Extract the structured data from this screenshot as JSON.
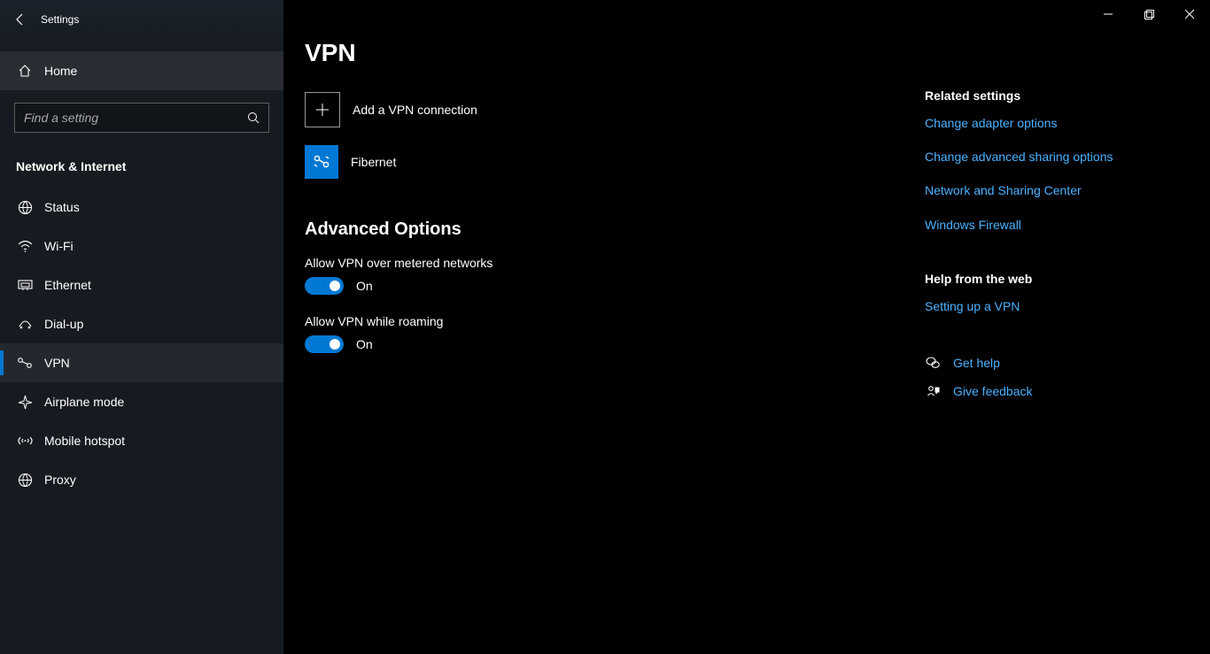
{
  "app_title": "Settings",
  "search_placeholder": "Find a setting",
  "home_label": "Home",
  "section_label": "Network & Internet",
  "nav": [
    {
      "id": "status",
      "label": "Status"
    },
    {
      "id": "wifi",
      "label": "Wi-Fi"
    },
    {
      "id": "ethernet",
      "label": "Ethernet"
    },
    {
      "id": "dialup",
      "label": "Dial-up"
    },
    {
      "id": "vpn",
      "label": "VPN"
    },
    {
      "id": "airplane",
      "label": "Airplane mode"
    },
    {
      "id": "hotspot",
      "label": "Mobile hotspot"
    },
    {
      "id": "proxy",
      "label": "Proxy"
    }
  ],
  "page_title": "VPN",
  "add_vpn_label": "Add a VPN connection",
  "vpn_connections": [
    {
      "name": "Fibernet"
    }
  ],
  "advanced_heading": "Advanced Options",
  "options": {
    "metered": {
      "label": "Allow VPN over metered networks",
      "state": "On"
    },
    "roaming": {
      "label": "Allow VPN while roaming",
      "state": "On"
    }
  },
  "rail": {
    "related_heading": "Related settings",
    "related_links": [
      "Change adapter options",
      "Change advanced sharing options",
      "Network and Sharing Center",
      "Windows Firewall"
    ],
    "help_heading": "Help from the web",
    "help_links": [
      "Setting up a VPN"
    ],
    "get_help": "Get help",
    "give_feedback": "Give feedback"
  }
}
